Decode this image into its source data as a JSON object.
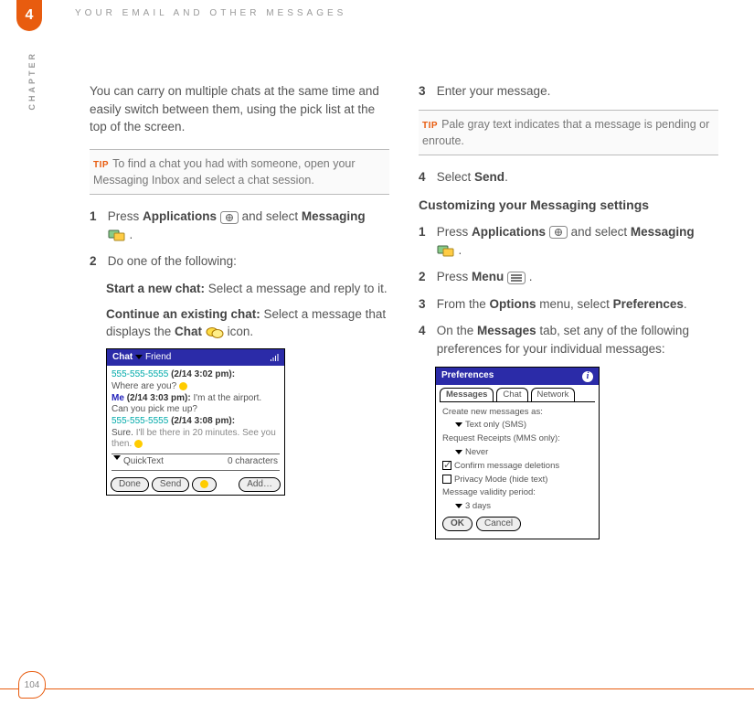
{
  "header": {
    "chapter_number": "4",
    "chapter_label": "CHAPTER",
    "title": "YOUR EMAIL AND OTHER MESSAGES"
  },
  "left": {
    "intro": "You can carry on multiple chats at the same time and easily switch between them, using the pick list at the top of the screen.",
    "tip": "To find a chat you had with someone, open your Messaging Inbox and select a chat session.",
    "step1_a": "Press ",
    "step1_b": "Applications",
    "step1_c": " and select ",
    "step1_d": "Messaging",
    "step1_e": " .",
    "step2": "Do one of the following:",
    "start_label": "Start a new chat:",
    "start_text": " Select a message and reply to it.",
    "cont_label": "Continue an existing chat:",
    "cont_text_a": " Select a message that displays the ",
    "cont_text_b": "Chat",
    "cont_text_c": " icon."
  },
  "chat_shot": {
    "title_left": "Chat",
    "title_friend": "Friend",
    "line1_num": "555-555-5555",
    "line1_ts": "(2/14 3:02 pm):",
    "line1_msg": "Where are you?",
    "line2_me": "Me",
    "line2_ts": "(2/14 3:03 pm):",
    "line2_msg": " I'm at the airport. Can you pick me up?",
    "line3_num": "555-555-5555",
    "line3_ts": "(2/14 3:08 pm):",
    "line3_msg_a": "Sure. ",
    "line3_msg_b": "I'll be there in 20 minutes. See you then.",
    "quicktext": "QuickText",
    "char_count": "0 characters",
    "btn_done": "Done",
    "btn_send": "Send",
    "btn_add": "Add…"
  },
  "right": {
    "step3": "Enter your message.",
    "tip": "Pale gray text indicates that a message is pending or enroute.",
    "step4_a": "Select ",
    "step4_b": "Send",
    "step4_c": ".",
    "section": "Customizing your Messaging settings",
    "r1_a": "Press ",
    "r1_b": "Applications",
    "r1_c": " and select ",
    "r1_d": "Messaging",
    "r1_e": " .",
    "r2_a": "Press ",
    "r2_b": "Menu",
    "r2_c": " .",
    "r3_a": "From the ",
    "r3_b": "Options",
    "r3_c": " menu, select ",
    "r3_d": "Preferences",
    "r3_e": ".",
    "r4_a": "On the ",
    "r4_b": "Messages",
    "r4_c": " tab, set any of the following preferences for your individual messages:"
  },
  "prefs_shot": {
    "title": "Preferences",
    "tab1": "Messages",
    "tab2": "Chat",
    "tab3": "Network",
    "l1": "Create new messages as:",
    "l1_val": "Text only (SMS)",
    "l2": "Request Receipts (MMS only):",
    "l2_val": "Never",
    "l3": "Confirm message deletions",
    "l4": "Privacy Mode (hide text)",
    "l5": "Message validity period:",
    "l5_val": "3 days",
    "btn_ok": "OK",
    "btn_cancel": "Cancel"
  },
  "tip_label": "TIP",
  "page_number": "104"
}
